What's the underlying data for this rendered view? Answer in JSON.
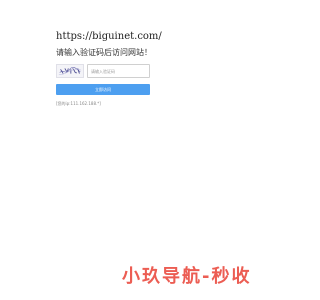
{
  "site_url": "https://biguinet.com/",
  "prompt": "请输入验证码后访问网站！",
  "captcha": {
    "input_placeholder": "请输入验证码"
  },
  "submit_label": "立即访问",
  "ip_line": "[您的ip:111.162.188.*]",
  "watermark": "小玖导航-秒收",
  "colors": {
    "button": "#4d9ff0",
    "watermark": "#ec5d53"
  }
}
